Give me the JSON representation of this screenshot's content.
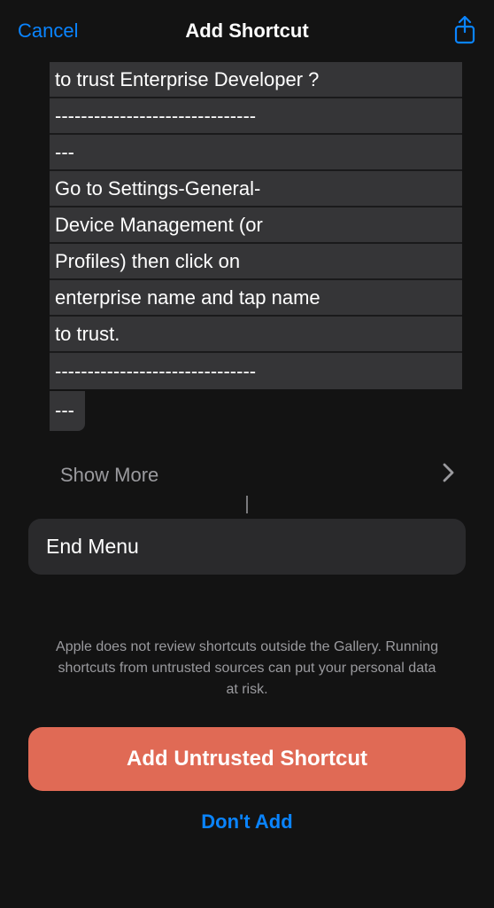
{
  "header": {
    "cancel_label": "Cancel",
    "title": "Add Shortcut"
  },
  "content": {
    "lines": [
      "to trust Enterprise Developer ?",
      "-------------------------------",
      "---",
      "Go to Settings-General-",
      "Device Management (or",
      "Profiles) then click on",
      "enterprise name and tap name",
      "to trust.",
      "-------------------------------"
    ],
    "trailing_dashes": "---",
    "show_more_label": "Show More",
    "end_menu_label": "End Menu"
  },
  "warning": "Apple does not review shortcuts outside the Gallery. Running shortcuts from untrusted sources can put your personal data at risk.",
  "buttons": {
    "add_untrusted_label": "Add Untrusted Shortcut",
    "dont_add_label": "Don't Add"
  }
}
